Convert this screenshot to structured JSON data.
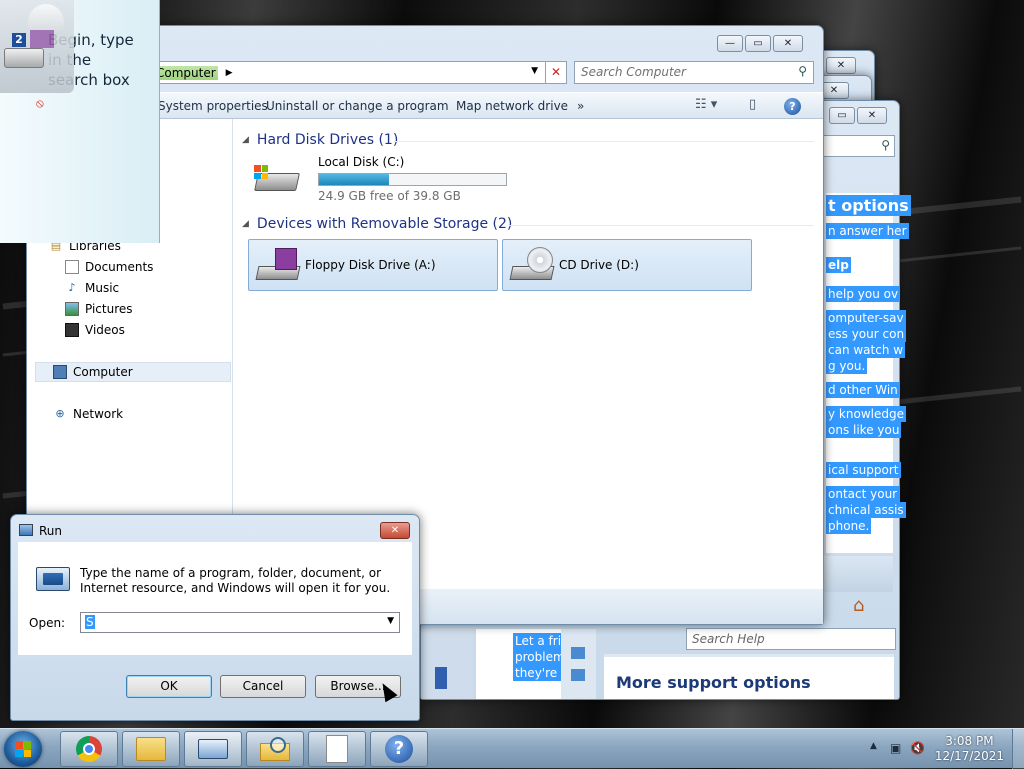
{
  "start_menu": {
    "search_hint": "Begin, type in the search box",
    "badge": "2"
  },
  "help_window": {
    "highlighted_lines": [
      "t options",
      "n answer her",
      "elp",
      "help you ov",
      "omputer-sav",
      "ess your con",
      "can watch w",
      "g you.",
      "d other Win",
      "y knowledge",
      "ons like you",
      "ical support",
      "ontact your",
      "chnical assis",
      "phone."
    ],
    "lower_lines": [
      "Let a frie",
      "problem",
      "they're h"
    ],
    "search_placeholder": "Search Help",
    "more_support": "More support options"
  },
  "explorer": {
    "breadcrumb": "Computer",
    "search_placeholder": "Search Computer",
    "toolbar": {
      "system_properties": "System properties",
      "uninstall": "Uninstall or change a program",
      "map_drive": "Map network drive",
      "more": "»"
    },
    "nav": {
      "libraries": "Libraries",
      "documents": "Documents",
      "music": "Music",
      "pictures": "Pictures",
      "videos": "Videos",
      "computer": "Computer",
      "network": "Network"
    },
    "hard_disk_group": "Hard Disk Drives (1)",
    "local_disk": {
      "name": "Local Disk (C:)",
      "free": "24.9 GB free of 39.8 GB",
      "used_fraction": 0.374
    },
    "removable_group": "Devices with Removable Storage (2)",
    "floppy": "Floppy Disk Drive (A:)",
    "cd": "CD Drive (D:)"
  },
  "run_dialog": {
    "title": "Run",
    "description": "Type the name of a program, folder, document, or Internet resource, and Windows will open it for you.",
    "open_label": "Open:",
    "open_value": "S",
    "ok": "OK",
    "cancel": "Cancel",
    "browse": "Browse..."
  },
  "taskbar": {
    "time": "3:08 PM",
    "date": "12/17/2021"
  }
}
